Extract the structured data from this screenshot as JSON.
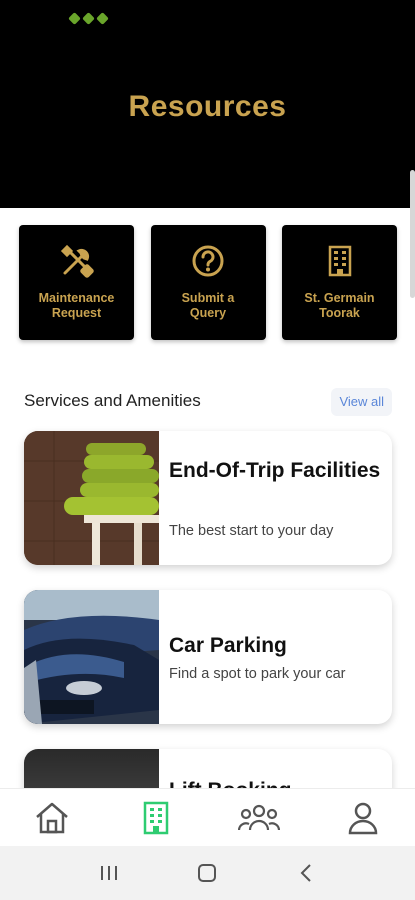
{
  "header": {
    "title": "Resources"
  },
  "quick_links": [
    {
      "label": "Maintenance\nRequest",
      "icon": "tools-icon"
    },
    {
      "label": "Submit a\nQuery",
      "icon": "question-circle-icon"
    },
    {
      "label": "St. Germain\nToorak",
      "icon": "building-icon"
    }
  ],
  "services": {
    "title": "Services and Amenities",
    "view_all": "View all",
    "cards": [
      {
        "title": "End-Of-Trip Facilities",
        "subtitle": "The best start to your day"
      },
      {
        "title": "Car Parking",
        "subtitle": "Find a spot to park your car"
      },
      {
        "title": "Lift Booking",
        "subtitle": ""
      }
    ]
  },
  "bottom_nav": {
    "items": [
      "home-icon",
      "building-icon",
      "community-icon",
      "profile-icon"
    ],
    "active": "building-icon"
  },
  "colors": {
    "accent_gold": "#c9a350",
    "active_green": "#2ecc71",
    "status_green": "#6aa52b"
  }
}
